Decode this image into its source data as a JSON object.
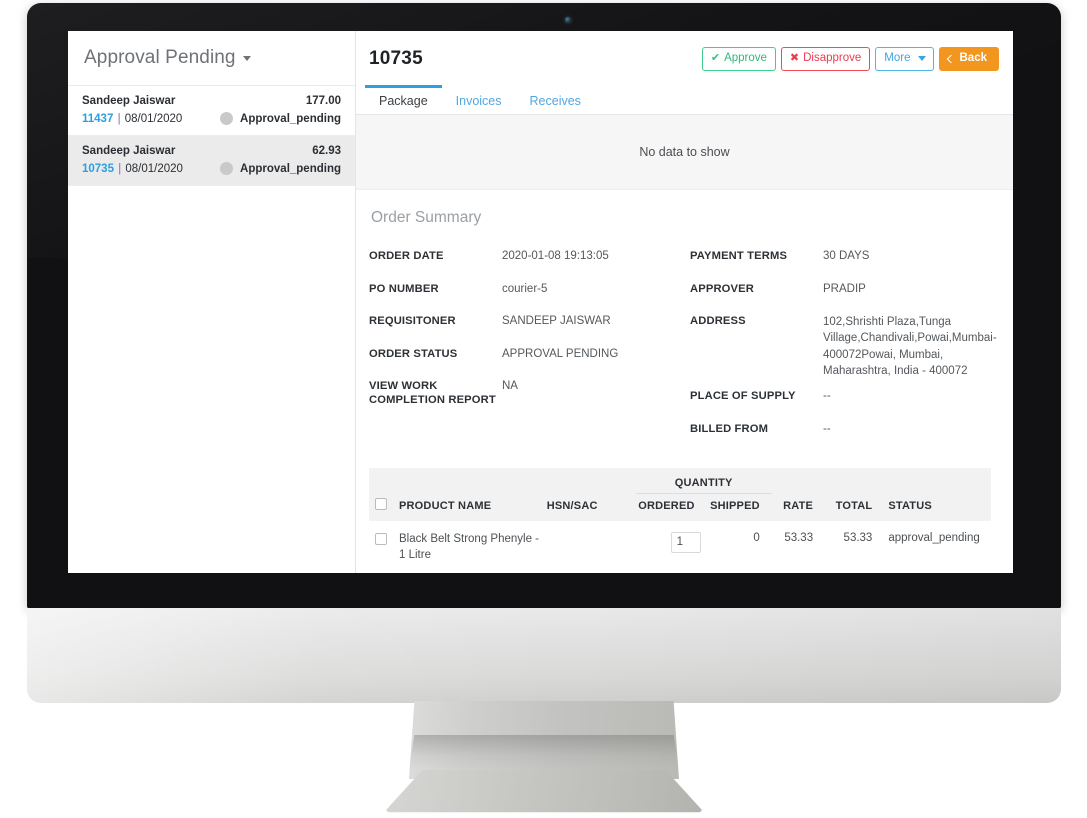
{
  "sidebar": {
    "title": "Approval Pending",
    "items": [
      {
        "name": "Sandeep Jaiswar",
        "amount": "177.00",
        "id": "11437",
        "separator": "|",
        "date": "08/01/2020",
        "status": "Approval_pending",
        "selected": false
      },
      {
        "name": "Sandeep Jaiswar",
        "amount": "62.93",
        "id": "10735",
        "separator": "|",
        "date": "08/01/2020",
        "status": "Approval_pending",
        "selected": true
      }
    ]
  },
  "header": {
    "order_number": "10735",
    "buttons": {
      "approve": "Approve",
      "approve_glyph": "✔",
      "disapprove": "Disapprove",
      "disapprove_glyph": "✖",
      "more": "More",
      "back": "Back"
    }
  },
  "tabs": [
    {
      "label": "Package",
      "active": true
    },
    {
      "label": "Invoices",
      "active": false
    },
    {
      "label": "Receives",
      "active": false
    }
  ],
  "package_panel": {
    "empty_message": "No data to show"
  },
  "order_summary": {
    "title": "Order Summary",
    "left_fields": [
      {
        "label": "ORDER DATE",
        "value": "2020-01-08 19:13:05"
      },
      {
        "label": "PO NUMBER",
        "value": "courier-5"
      },
      {
        "label": "REQUISITONER",
        "value": "SANDEEP JAISWAR"
      },
      {
        "label": "ORDER STATUS",
        "value": "APPROVAL PENDING"
      },
      {
        "label": "VIEW WORK COMPLETION REPORT",
        "value": "NA"
      }
    ],
    "right_fields": [
      {
        "label": "PAYMENT TERMS",
        "value": "30 DAYS"
      },
      {
        "label": "APPROVER",
        "value": "PRADIP"
      },
      {
        "label": "ADDRESS",
        "value": "102,Shrishti Plaza,Tunga Village,Chandivali,Powai,Mumbai-400072Powai, Mumbai, Maharashtra, India - 400072"
      },
      {
        "label": "PLACE OF SUPPLY",
        "value": "--"
      },
      {
        "label": "BILLED FROM",
        "value": "--"
      }
    ]
  },
  "product_table": {
    "group_header": "QUANTITY",
    "columns": {
      "product_name": "PRODUCT NAME",
      "hsn_sac": "HSN/SAC",
      "ordered": "ORDERED",
      "shipped": "SHIPPED",
      "rate": "RATE",
      "total": "TOTAL",
      "status": "STATUS"
    },
    "rows": [
      {
        "product_name": "Black Belt Strong Phenyle - 1 Litre",
        "hsn_sac": "",
        "ordered": "1",
        "shipped": "0",
        "rate": "53.33",
        "total": "53.33",
        "status": "approval_pending"
      }
    ]
  },
  "colors": {
    "approve_green": "#3ecf8e",
    "disapprove_red": "#f1485c",
    "more_blue": "#4fb4e8",
    "back_orange": "#f2961f",
    "tab_active": "#2e9fe0",
    "link_blue": "#2b9fe0",
    "status_dot": "#c9c9c9"
  }
}
